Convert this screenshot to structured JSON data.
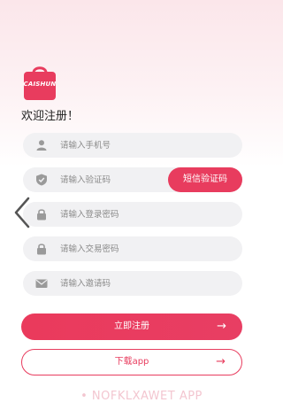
{
  "logo": {
    "text": "CAISHUN",
    "brand_color": "#e83c5e"
  },
  "welcome": "欢迎注册！",
  "fields": [
    {
      "icon": "user-icon",
      "placeholder": "请输入手机号"
    },
    {
      "icon": "shield-icon",
      "placeholder": "请输入验证码"
    },
    {
      "icon": "lock-icon",
      "placeholder": "请输入登录密码"
    },
    {
      "icon": "lock-icon",
      "placeholder": "请输入交易密码"
    },
    {
      "icon": "mail-icon",
      "placeholder": "请输入邀请码"
    }
  ],
  "sms_button": "短信验证码",
  "register_button": {
    "label": "立即注册",
    "arrow": "→"
  },
  "download_button": {
    "label": "下载app",
    "arrow": "→"
  },
  "watermark": "• NOFKLXAWET APP",
  "colors": {
    "accent": "#e83c5e",
    "field_bg": "#f1f1f3",
    "icon_gray": "#9a9a9a"
  }
}
